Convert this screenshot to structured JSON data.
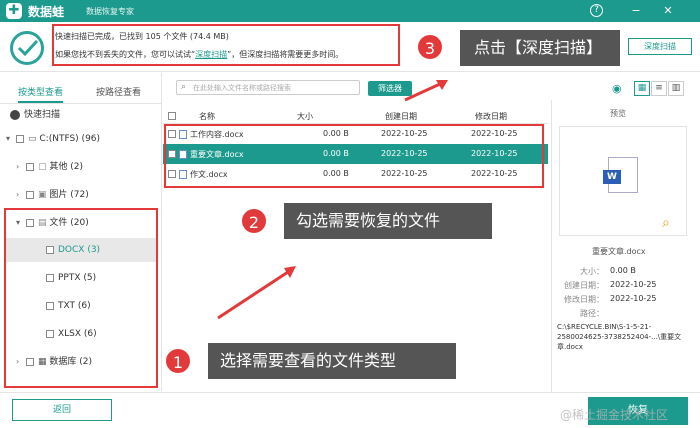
{
  "titlebar": {
    "logo_char": "✚",
    "app_name": "数据蛙",
    "app_sub": "数据恢复专家",
    "help": "?",
    "minimize": "−",
    "close": "✕"
  },
  "header": {
    "status_line1": "快速扫描已完成，已找到 105 个文件 (74.4 MB)",
    "status_line2_pre": "如果您找不到丢失的文件，您可以试试“",
    "status_line2_link": "深度扫描",
    "status_line2_post": "”，但深度扫描将需要更多时间。",
    "deep_scan_button": "深度扫描"
  },
  "callouts": {
    "c1_num": "1",
    "c1_text": "选择需要查看的文件类型",
    "c2_num": "2",
    "c2_text": "勾选需要恢复的文件",
    "c3_num": "3",
    "c3_text": "点击【深度扫描】"
  },
  "left": {
    "tab_type": "按类型查看",
    "tab_path": "按路径查看",
    "quick_scan": "快速扫描",
    "drive": "C:(NTFS) (96)",
    "other": "其他 (2)",
    "images": "图片 (72)",
    "files": "文件 (20)",
    "docx": "DOCX (3)",
    "pptx": "PPTX (5)",
    "txt": "TXT (6)",
    "xlsx": "XLSX (6)",
    "database": "数据库 (2)"
  },
  "toolbar": {
    "search_placeholder": "在此处输入文件名称或路径搜索",
    "filter_button": "筛选器"
  },
  "table": {
    "headers": [
      "名称",
      "大小",
      "创建日期",
      "修改日期"
    ],
    "rows": [
      {
        "name": "工作内容.docx",
        "size": "0.00  B",
        "created": "2022-10-25",
        "modified": "2022-10-25"
      },
      {
        "name": "重要文章.docx",
        "size": "0.00  B",
        "created": "2022-10-25",
        "modified": "2022-10-25"
      },
      {
        "name": "作文.docx",
        "size": "0.00  B",
        "created": "2022-10-25",
        "modified": "2022-10-25"
      }
    ]
  },
  "preview": {
    "title": "预览",
    "filename": "重要文章.docx",
    "size_label": "大小：",
    "size_value": "0.00  B",
    "created_label": "创建日期：",
    "created_value": "2022-10-25",
    "modified_label": "修改日期：",
    "modified_value": "2022-10-25",
    "path_label": "路径：",
    "path_value": "C:\\$RECYCLE.BIN\\S-1-5-21-2580024625-3738252404-...\\重要文章.docx"
  },
  "footer": {
    "back_button": "返回",
    "recover_button": "恢复",
    "watermark": "@稀土掘金技术社区"
  },
  "colors": {
    "accent": "#1d9a8e",
    "callout_red": "#e23a3a",
    "callout_bg": "#555555"
  }
}
